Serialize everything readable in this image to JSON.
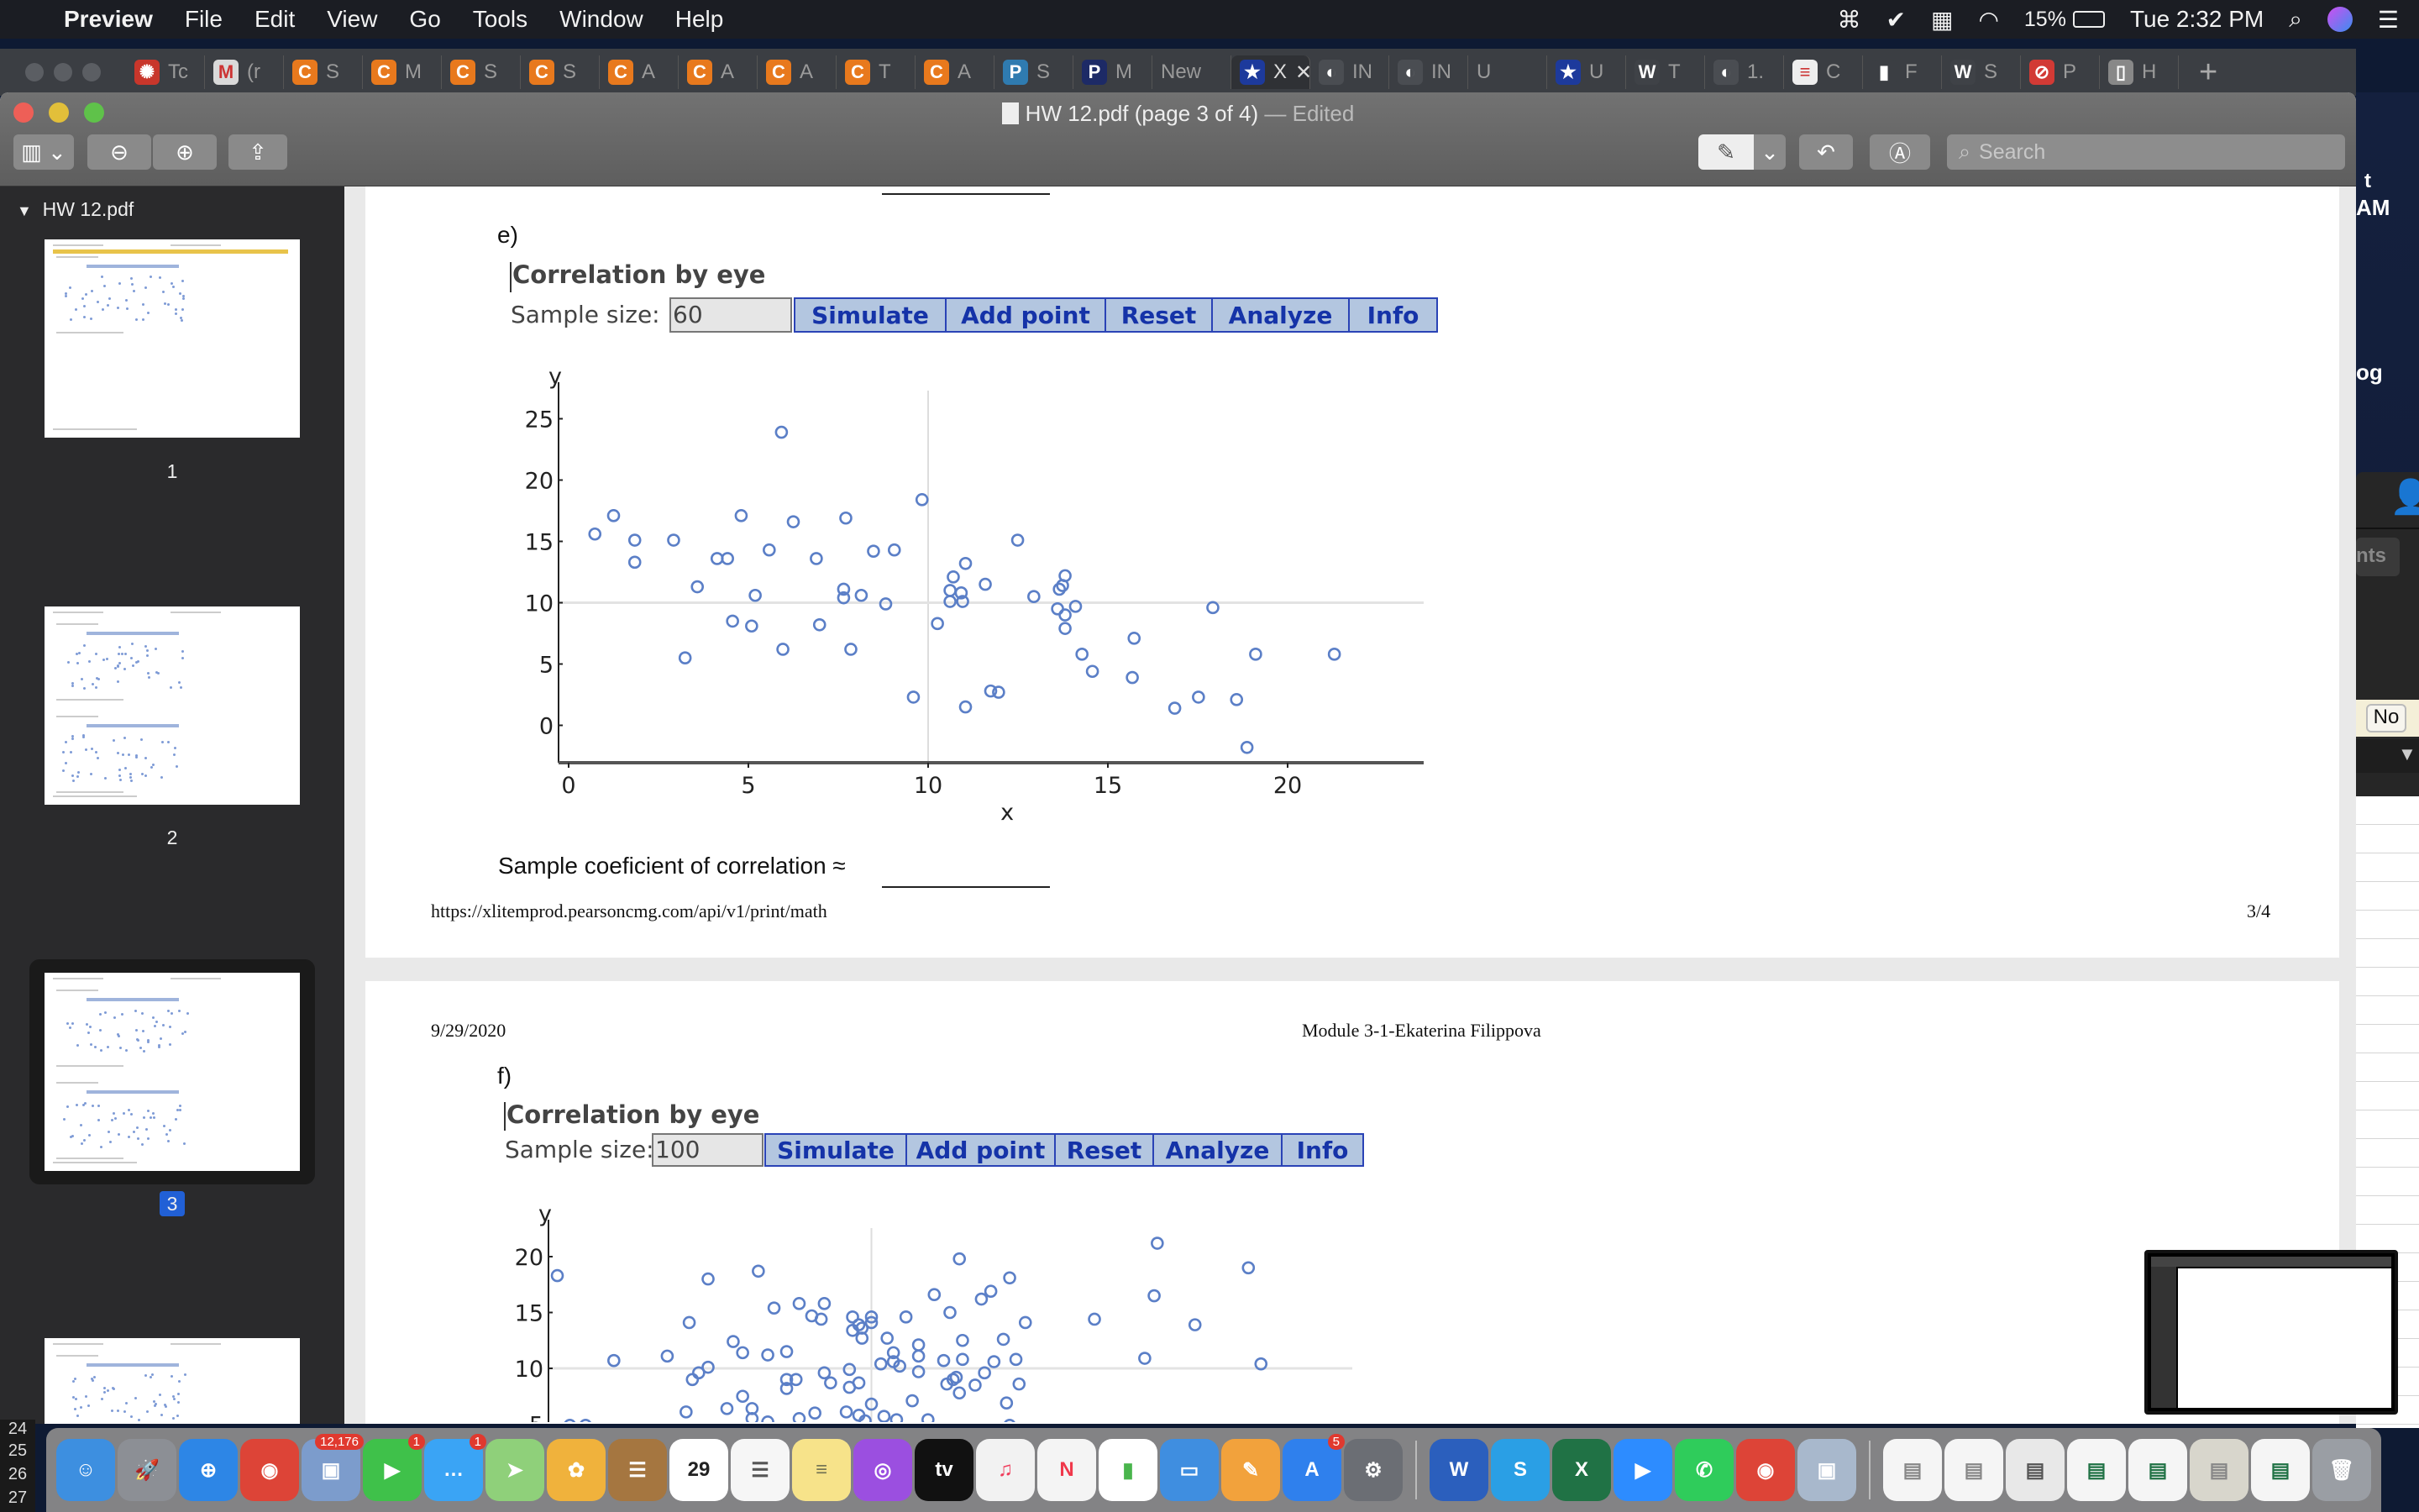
{
  "menubar": {
    "app": "Preview",
    "items": [
      "File",
      "Edit",
      "View",
      "Go",
      "Tools",
      "Window",
      "Help"
    ],
    "battery": "15%",
    "clock": "Tue 2:32 PM"
  },
  "browser_tabs": [
    {
      "label": "Tc",
      "icon": "canvas-icon",
      "color": "#c8362b",
      "glyph": "✺"
    },
    {
      "label": "(r",
      "icon": "gmail-icon",
      "color": "#d9d9d9",
      "glyph": "M"
    },
    {
      "label": "S",
      "icon": "chegg-icon",
      "color": "#e8791d",
      "glyph": "C"
    },
    {
      "label": "M",
      "icon": "chegg-icon",
      "color": "#e8791d",
      "glyph": "C"
    },
    {
      "label": "S",
      "icon": "chegg-icon",
      "color": "#e8791d",
      "glyph": "C"
    },
    {
      "label": "S",
      "icon": "chegg-icon",
      "color": "#e8791d",
      "glyph": "C"
    },
    {
      "label": "A",
      "icon": "chegg-icon",
      "color": "#e8791d",
      "glyph": "C"
    },
    {
      "label": "A",
      "icon": "chegg-icon",
      "color": "#e8791d",
      "glyph": "C"
    },
    {
      "label": "A",
      "icon": "chegg-icon",
      "color": "#e8791d",
      "glyph": "C"
    },
    {
      "label": "T",
      "icon": "chegg-icon",
      "color": "#e8791d",
      "glyph": "C"
    },
    {
      "label": "A",
      "icon": "chegg-icon",
      "color": "#e8791d",
      "glyph": "C"
    },
    {
      "label": "S",
      "icon": "pearson-icon",
      "color": "#2f7bb0",
      "glyph": "P"
    },
    {
      "label": "M",
      "icon": "pearson-icon",
      "color": "#1d2a66",
      "glyph": "P"
    },
    {
      "label": "New",
      "icon": "",
      "color": "",
      "glyph": ""
    },
    {
      "label": "X",
      "icon": "star-bookmark-icon",
      "color": "#1d3a9c",
      "glyph": "★",
      "active": true
    },
    {
      "label": "IN",
      "icon": "globe-icon",
      "color": "#4a4d52",
      "glyph": "◐"
    },
    {
      "label": "IN",
      "icon": "globe-icon",
      "color": "#4a4d52",
      "glyph": "◐"
    },
    {
      "label": "U",
      "icon": "",
      "color": "",
      "glyph": ""
    },
    {
      "label": "U",
      "icon": "star-bookmark-icon",
      "color": "#1d3a9c",
      "glyph": "★"
    },
    {
      "label": "T",
      "icon": "wordpress-icon",
      "color": "#3f4247",
      "glyph": "W"
    },
    {
      "label": "1.",
      "icon": "globe-icon",
      "color": "#4a4d52",
      "glyph": "◐"
    },
    {
      "label": "C",
      "icon": "social-science-statistics-icon",
      "color": "#eeeeee",
      "glyph": "≡"
    },
    {
      "label": "F",
      "icon": "bar-chart-icon",
      "color": "#3b3e43",
      "glyph": "▮"
    },
    {
      "label": "S",
      "icon": "wordpress-icon",
      "color": "#3f4247",
      "glyph": "W"
    },
    {
      "label": "P",
      "icon": "blocked-icon",
      "color": "#d23a35",
      "glyph": "⊘"
    },
    {
      "label": "H",
      "icon": "page-icon",
      "color": "#888888",
      "glyph": "▯"
    }
  ],
  "window": {
    "title": "HW 12.pdf (page 3 of 4)",
    "edited": " — Edited",
    "search_placeholder": "Search"
  },
  "sidebar": {
    "doc_name": "HW 12.pdf",
    "pages": [
      "1",
      "2",
      "3"
    ],
    "selected_page": "3"
  },
  "page3": {
    "part": "e)",
    "widget_title": "Correlation by eye",
    "sample_label": "Sample size:",
    "sample_value": "60",
    "buttons": [
      "Simulate",
      "Add point",
      "Reset",
      "Analyze",
      "Info"
    ],
    "coef_label": "Sample coeficient of correlation  ≈",
    "footer_url": "https://xlitemprod.pearsoncmg.com/api/v1/print/math",
    "footer_page": "3/4"
  },
  "page4": {
    "date": "9/29/2020",
    "header": "Module 3-1-Ekaterina Filippova",
    "part": "f)",
    "widget_title": "Correlation by eye",
    "sample_label": "Sample size:",
    "sample_value": "100",
    "buttons": [
      "Simulate",
      "Add point",
      "Reset",
      "Analyze",
      "Info"
    ]
  },
  "chart_data": [
    {
      "type": "scatter",
      "xlabel": "x",
      "ylabel": "y",
      "xlim": [
        0,
        24
      ],
      "ylim": [
        -3,
        26
      ],
      "xticks": [
        0,
        5,
        10,
        15,
        20
      ],
      "yticks": [
        0,
        5,
        10,
        15,
        20,
        25
      ],
      "grid": "reference lines at x=10, y=10",
      "marker_color": "#5b7fc7",
      "points": [
        [
          0.73,
          15.6
        ],
        [
          1.25,
          17.1
        ],
        [
          1.84,
          15.1
        ],
        [
          1.84,
          13.3
        ],
        [
          2.92,
          15.1
        ],
        [
          3.24,
          5.5
        ],
        [
          3.58,
          11.3
        ],
        [
          4.13,
          13.6
        ],
        [
          4.42,
          13.6
        ],
        [
          4.56,
          8.5
        ],
        [
          4.8,
          17.1
        ],
        [
          5.09,
          8.1
        ],
        [
          5.19,
          10.6
        ],
        [
          5.58,
          14.3
        ],
        [
          5.92,
          23.9
        ],
        [
          5.96,
          6.2
        ],
        [
          6.25,
          16.6
        ],
        [
          6.89,
          13.6
        ],
        [
          6.98,
          8.2
        ],
        [
          7.65,
          11.1
        ],
        [
          7.65,
          10.4
        ],
        [
          7.71,
          16.9
        ],
        [
          7.85,
          6.2
        ],
        [
          8.14,
          10.6
        ],
        [
          8.48,
          14.2
        ],
        [
          8.82,
          9.9
        ],
        [
          9.06,
          14.3
        ],
        [
          9.59,
          2.3
        ],
        [
          9.83,
          18.4
        ],
        [
          10.26,
          8.3
        ],
        [
          10.61,
          11.0
        ],
        [
          10.61,
          10.1
        ],
        [
          10.7,
          12.1
        ],
        [
          10.92,
          10.8
        ],
        [
          10.96,
          10.1
        ],
        [
          11.04,
          13.2
        ],
        [
          11.04,
          1.5
        ],
        [
          11.59,
          11.5
        ],
        [
          11.74,
          2.8
        ],
        [
          11.96,
          2.7
        ],
        [
          12.49,
          15.1
        ],
        [
          12.94,
          10.5
        ],
        [
          13.6,
          9.5
        ],
        [
          13.65,
          11.1
        ],
        [
          13.74,
          11.4
        ],
        [
          13.81,
          12.2
        ],
        [
          13.81,
          9.0
        ],
        [
          13.81,
          7.9
        ],
        [
          14.1,
          9.7
        ],
        [
          14.28,
          5.8
        ],
        [
          14.57,
          4.4
        ],
        [
          15.68,
          3.9
        ],
        [
          15.73,
          7.1
        ],
        [
          16.86,
          1.4
        ],
        [
          17.52,
          2.3
        ],
        [
          17.92,
          9.6
        ],
        [
          18.58,
          2.1
        ],
        [
          18.87,
          -1.8
        ],
        [
          19.11,
          5.8
        ],
        [
          21.3,
          5.8
        ]
      ]
    },
    {
      "type": "scatter",
      "ylabel": "y",
      "ylim": [
        5,
        22
      ],
      "yticks": [
        5,
        10,
        15,
        20
      ],
      "grid": "reference lines at x=10, y=10",
      "marker_color": "#5b7fc7",
      "points": [
        [
          0.0,
          18.3
        ],
        [
          0.4,
          4.9
        ],
        [
          0.9,
          4.9
        ],
        [
          1.8,
          10.7
        ],
        [
          3.5,
          11.1
        ],
        [
          4.2,
          14.1
        ],
        [
          4.3,
          9.0
        ],
        [
          4.5,
          9.6
        ],
        [
          4.8,
          18.0
        ],
        [
          4.8,
          10.1
        ],
        [
          4.1,
          6.1
        ],
        [
          5.4,
          6.4
        ],
        [
          5.6,
          12.4
        ],
        [
          5.9,
          11.4
        ],
        [
          5.9,
          7.5
        ],
        [
          6.2,
          6.4
        ],
        [
          6.2,
          5.5
        ],
        [
          6.4,
          18.7
        ],
        [
          6.7,
          11.2
        ],
        [
          6.7,
          5.2
        ],
        [
          6.9,
          15.4
        ],
        [
          7.3,
          11.5
        ],
        [
          7.3,
          8.2
        ],
        [
          7.3,
          9.0
        ],
        [
          7.6,
          9.0
        ],
        [
          7.7,
          15.8
        ],
        [
          7.7,
          5.5
        ],
        [
          8.1,
          14.7
        ],
        [
          8.2,
          6.0
        ],
        [
          8.4,
          14.4
        ],
        [
          8.5,
          15.8
        ],
        [
          8.5,
          9.6
        ],
        [
          8.7,
          8.7
        ],
        [
          9.2,
          6.1
        ],
        [
          9.3,
          8.3
        ],
        [
          9.3,
          9.9
        ],
        [
          9.4,
          13.4
        ],
        [
          9.4,
          14.6
        ],
        [
          9.6,
          8.7
        ],
        [
          9.6,
          5.8
        ],
        [
          9.6,
          13.9
        ],
        [
          9.7,
          12.7
        ],
        [
          9.7,
          13.6
        ],
        [
          9.8,
          5.3
        ],
        [
          10.0,
          14.6
        ],
        [
          10.0,
          14.1
        ],
        [
          10.0,
          6.8
        ],
        [
          10.3,
          10.4
        ],
        [
          10.4,
          5.7
        ],
        [
          10.5,
          12.7
        ],
        [
          10.7,
          11.4
        ],
        [
          10.7,
          10.6
        ],
        [
          10.8,
          5.4
        ],
        [
          10.9,
          10.2
        ],
        [
          11.1,
          14.6
        ],
        [
          11.3,
          7.1
        ],
        [
          11.5,
          12.1
        ],
        [
          11.5,
          11.1
        ],
        [
          11.5,
          9.7
        ],
        [
          11.8,
          5.4
        ],
        [
          12.0,
          16.6
        ],
        [
          12.3,
          10.7
        ],
        [
          12.4,
          8.6
        ],
        [
          12.5,
          15.0
        ],
        [
          12.6,
          9.0
        ],
        [
          12.7,
          9.2
        ],
        [
          12.8,
          7.8
        ],
        [
          12.8,
          19.8
        ],
        [
          12.9,
          10.8
        ],
        [
          12.9,
          12.5
        ],
        [
          13.3,
          8.5
        ],
        [
          13.5,
          16.2
        ],
        [
          13.6,
          9.6
        ],
        [
          13.8,
          16.9
        ],
        [
          13.9,
          10.6
        ],
        [
          14.2,
          12.6
        ],
        [
          14.3,
          6.9
        ],
        [
          14.4,
          18.1
        ],
        [
          14.4,
          4.9
        ],
        [
          14.6,
          10.8
        ],
        [
          14.7,
          8.6
        ],
        [
          14.9,
          14.1
        ],
        [
          17.1,
          14.4
        ],
        [
          18.7,
          10.9
        ],
        [
          19.0,
          16.5
        ],
        [
          19.1,
          21.2
        ],
        [
          20.3,
          13.9
        ],
        [
          22.0,
          19.0
        ],
        [
          22.4,
          10.4
        ]
      ]
    }
  ],
  "right_strip": {
    "t1": "t",
    "t2": "AM",
    "t3": "og",
    "t4": "nts",
    "t5": "No"
  },
  "spreadsheet_rows": [
    "24",
    "25",
    "26",
    "27"
  ],
  "dock": [
    {
      "name": "finder-icon",
      "color": "#3d8fe0",
      "glyph": "☺"
    },
    {
      "name": "launchpad-icon",
      "color": "#8c8f95",
      "glyph": "🚀"
    },
    {
      "name": "safari-icon",
      "color": "#2d86e6",
      "glyph": "⊕"
    },
    {
      "name": "chrome-icon",
      "color": "#dd4437",
      "glyph": "◉"
    },
    {
      "name": "preview-app-icon",
      "color": "#7c9ccc",
      "glyph": "▣",
      "badge": "12,176"
    },
    {
      "name": "facetime-icon",
      "color": "#3fc14a",
      "glyph": "▶",
      "badge": "1"
    },
    {
      "name": "messages-icon",
      "color": "#3aa4f5",
      "glyph": "…",
      "badge": "1"
    },
    {
      "name": "maps-icon",
      "color": "#8fd07a",
      "glyph": "➤"
    },
    {
      "name": "photos-icon",
      "color": "#f0b23c",
      "glyph": "✿"
    },
    {
      "name": "contacts-icon",
      "color": "#a57640",
      "glyph": "☰"
    },
    {
      "name": "calendar-icon",
      "color": "#ffffff",
      "glyph": "29",
      "text_color": "#222"
    },
    {
      "name": "reminders-icon",
      "color": "#f6f6f6",
      "glyph": "☰",
      "text_color": "#555"
    },
    {
      "name": "notes-icon",
      "color": "#f7e38a",
      "glyph": "≡",
      "text_color": "#775"
    },
    {
      "name": "podcasts-icon",
      "color": "#9b4fe0",
      "glyph": "◎"
    },
    {
      "name": "apple-tv-icon",
      "color": "#111111",
      "glyph": "tv"
    },
    {
      "name": "music-icon",
      "color": "#f2f2f2",
      "glyph": "♫",
      "text_color": "#f03c5b"
    },
    {
      "name": "news-icon",
      "color": "#f4f4f4",
      "glyph": "N",
      "text_color": "#f0384b"
    },
    {
      "name": "numbers-icon",
      "color": "#ffffff",
      "glyph": "▮",
      "text_color": "#49b54c"
    },
    {
      "name": "keynote-icon",
      "color": "#3f8ee0",
      "glyph": "▭"
    },
    {
      "name": "pages-icon",
      "color": "#f2a23c",
      "glyph": "✎"
    },
    {
      "name": "app-store-icon",
      "color": "#2f80ed",
      "glyph": "A",
      "badge": "5"
    },
    {
      "name": "system-preferences-icon",
      "color": "#6b6e74",
      "glyph": "⚙"
    },
    {
      "sep": true
    },
    {
      "name": "word-icon",
      "color": "#2b5fbd",
      "glyph": "W"
    },
    {
      "name": "skype-icon",
      "color": "#2a9fe5",
      "glyph": "S"
    },
    {
      "name": "excel-icon",
      "color": "#207245",
      "glyph": "X"
    },
    {
      "name": "zoom-icon",
      "color": "#2d8cff",
      "glyph": "▶"
    },
    {
      "name": "whatsapp-icon",
      "color": "#2fcc5b",
      "glyph": "✆"
    },
    {
      "name": "chrome-icon",
      "color": "#dd4437",
      "glyph": "◉"
    },
    {
      "name": "preview-icon",
      "color": "#a8b8cc",
      "glyph": "▣"
    },
    {
      "sep": true
    },
    {
      "name": "minimized-window-icon",
      "color": "#f5f5f5",
      "glyph": "▤",
      "text_color": "#888"
    },
    {
      "name": "minimized-window-icon",
      "color": "#f5f5f5",
      "glyph": "▤",
      "text_color": "#888"
    },
    {
      "name": "minimized-window-icon",
      "color": "#e8e8e8",
      "glyph": "▤",
      "text_color": "#555"
    },
    {
      "name": "minimized-window-icon",
      "color": "#f5f5f5",
      "glyph": "▤",
      "text_color": "#207245"
    },
    {
      "name": "minimized-window-icon",
      "color": "#f5f5f5",
      "glyph": "▤",
      "text_color": "#207245"
    },
    {
      "name": "minimized-window-icon",
      "color": "#d8d6cc",
      "glyph": "▤",
      "text_color": "#888"
    },
    {
      "name": "minimized-window-icon",
      "color": "#f5f5f5",
      "glyph": "▤",
      "text_color": "#207245"
    },
    {
      "name": "trash-icon",
      "color": "#9a9ea4",
      "glyph": "🗑"
    }
  ]
}
